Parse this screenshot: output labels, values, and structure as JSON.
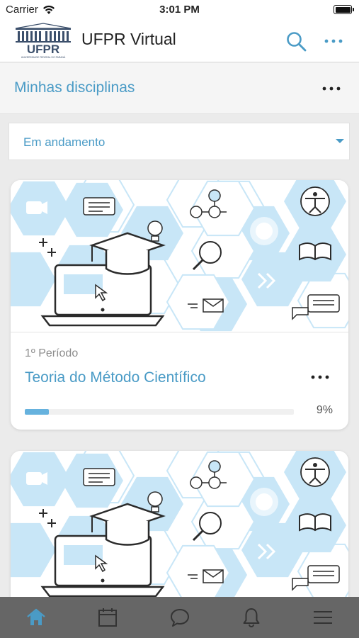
{
  "status_bar": {
    "carrier": "Carrier",
    "time": "3:01 PM",
    "wifi_icon": "wifi-icon",
    "battery_icon": "battery-icon",
    "battery_level": 1.0
  },
  "header": {
    "logo_text": "UFPR",
    "logo_subtext": "UNIVERSIDADE FEDERAL DO PARANÁ",
    "title": "UFPR Virtual",
    "search_icon": "search-icon",
    "more_icon": "more-horizontal-icon"
  },
  "section": {
    "title": "Minhas disciplinas",
    "more_icon": "more-horizontal-icon"
  },
  "filter": {
    "selected": "Em andamento",
    "caret_icon": "caret-down-icon"
  },
  "courses": [
    {
      "period": "1º Período",
      "title": "Teoria do Método Científico",
      "progress": 9,
      "progress_label": "9%"
    },
    {
      "period": "",
      "title": "",
      "progress": null,
      "progress_label": ""
    }
  ],
  "tabs": [
    {
      "icon": "home-icon",
      "active": true
    },
    {
      "icon": "calendar-icon",
      "active": false
    },
    {
      "icon": "chat-icon",
      "active": false
    },
    {
      "icon": "bell-icon",
      "active": false
    },
    {
      "icon": "menu-icon",
      "active": false
    }
  ],
  "colors": {
    "accent": "#4a9bc6",
    "hexagon": "#c8e6f7",
    "tab_bar": "#666666",
    "tab_active": "#4a9bc6",
    "tab_inactive": "#333333"
  }
}
